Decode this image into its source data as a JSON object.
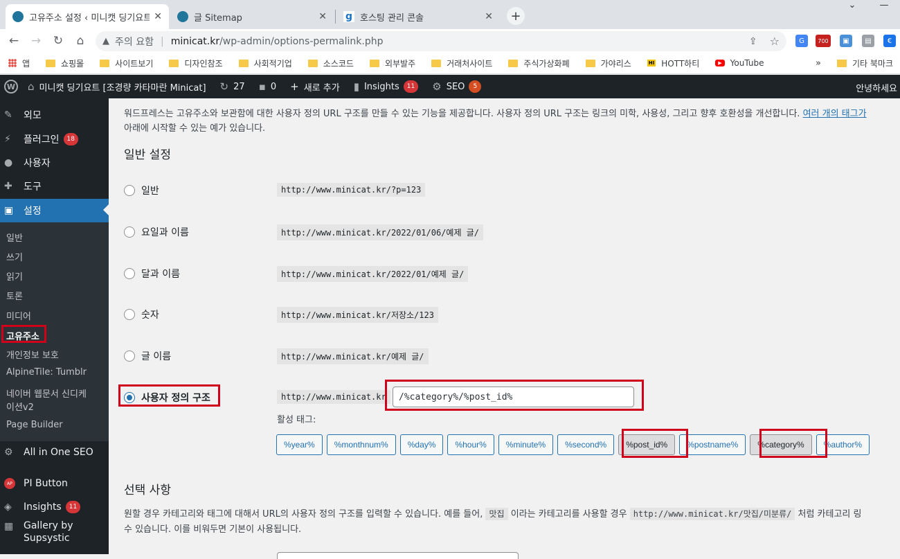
{
  "browser": {
    "tabs": [
      {
        "title": "고유주소 설정 ‹ 미니캣 딩기요트 [조경량",
        "close": "✕"
      },
      {
        "title": "글 Sitemap",
        "close": "✕"
      },
      {
        "title": "호스팅 관리 콘솔",
        "close": "✕"
      }
    ],
    "new_tab": "+",
    "window_controls": [
      "⌄",
      "—"
    ],
    "security_label": "주의 요함",
    "url_host": "minicat.kr",
    "url_path": "/wp-admin/options-permalink.php",
    "toolbar_badge": "700",
    "bookmarks": [
      "앱",
      "쇼핑몰",
      "사이트보기",
      "디자인참조",
      "사회적기업",
      "소스코드",
      "외부발주",
      "거래처사이트",
      "주식가상화폐",
      "가야리스",
      "HOTT하티",
      "YouTube"
    ],
    "bookmarks_more": "»",
    "other_bookmarks": "기타 북마크"
  },
  "adminbar": {
    "site_name": "미니캣 딩기요트 [조경량 카타마란 Minicat]",
    "updates_count": "27",
    "comments_count": "0",
    "new_label": "새로 추가",
    "insights_label": "Insights",
    "insights_badge": "11",
    "seo_label": "SEO",
    "seo_badge": "5",
    "greeting": "안녕하세요"
  },
  "sidebar": {
    "items": [
      {
        "label": "외모"
      },
      {
        "label": "플러그인",
        "badge": "18"
      },
      {
        "label": "사용자"
      },
      {
        "label": "도구"
      },
      {
        "label": "설정"
      }
    ],
    "submenu": [
      "일반",
      "쓰기",
      "읽기",
      "토론",
      "미디어",
      "고유주소",
      "개인정보 보호",
      "AlpineTile: Tumblr",
      "네이버 웹문서 신디케",
      "이션v2",
      "Page Builder"
    ],
    "lower_items": [
      {
        "label": "All in One SEO"
      },
      {
        "label": "PI Button"
      },
      {
        "label": "Insights",
        "badge": "11"
      },
      {
        "label": "Gallery by"
      },
      {
        "label": "Supsystic"
      }
    ]
  },
  "main": {
    "intro_line1": "워드프레스는 고유주소와 보관함에 대한 사용자 정의 URL 구조를 만들 수 있는 기능을 제공합니다. 사용자 정의 URL 구조는 링크의 미학, 사용성, 그리고 향후 호환성을 개선합니다.",
    "intro_link": "여러 개의 태그가",
    "intro_line2": "아래에 시작할 수 있는 예가 있습니다.",
    "common_heading": "일반 설정",
    "options": [
      {
        "label": "일반",
        "example": "http://www.minicat.kr/?p=123"
      },
      {
        "label": "요일과 이름",
        "example": "http://www.minicat.kr/2022/01/06/예제 글/"
      },
      {
        "label": "달과 이름",
        "example": "http://www.minicat.kr/2022/01/예제 글/"
      },
      {
        "label": "숫자",
        "example": "http://www.minicat.kr/저장소/123"
      },
      {
        "label": "글 이름",
        "example": "http://www.minicat.kr/예제 글/"
      },
      {
        "label": "사용자 정의 구조",
        "example": "http://www.minicat.kr"
      }
    ],
    "selected_option": "사용자 정의 구조",
    "custom_structure_value": "/%category%/%post_id%",
    "available_tags_label": "활성 태그:",
    "tags": [
      "%year%",
      "%monthnum%",
      "%day%",
      "%hour%",
      "%minute%",
      "%second%",
      "%post_id%",
      "%postname%",
      "%category%",
      "%author%"
    ],
    "selected_tags": [
      "%post_id%",
      "%category%"
    ],
    "optional_heading": "선택 사항",
    "optional_desc_a": "원할 경우 카테고리와 태그에 대해서 URL의 사용자 정의 구조를 입력할 수 있습니다. 예를 들어,",
    "optional_code_1": "맛집",
    "optional_desc_b": "이라는 카테고리를 사용할 경우",
    "optional_code_2": "http://www.minicat.kr/맛집/미분류/",
    "optional_desc_c": "처럼 카테고리 링",
    "optional_desc_line2": "수 있습니다. 이를 비워두면 기본이 사용됩니다."
  },
  "colors": {
    "accent": "#2271b1",
    "admin_dark": "#1d2327",
    "badge_red": "#d63638",
    "highlight_red": "#d0021b"
  }
}
